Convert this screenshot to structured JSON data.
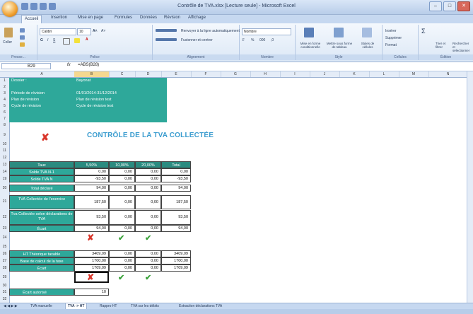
{
  "window": {
    "title": "Contrôle de TVA.xlsx [Lecture seule] - Microsoft Excel",
    "buttons": [
      "–",
      "□",
      "✕"
    ]
  },
  "ribbon_tabs": [
    "Accueil",
    "Insertion",
    "Mise en page",
    "Formules",
    "Données",
    "Révision",
    "Affichage"
  ],
  "ribbon": {
    "paste_label": "Coller",
    "font_name": "Calibri",
    "font_size": "10",
    "wrap_text": "Renvoyer à la ligne automatiquement",
    "merge_center": "Fusionner et centrer",
    "number_format": "Nombre",
    "conditional": "Mise en forme conditionnelle",
    "format_table": "Mettre sous forme de tableau",
    "cell_styles": "Styles de cellules",
    "insert": "Insérer",
    "delete": "Supprimer",
    "format": "Format",
    "sort_filter": "Trier et filtrer",
    "find_select": "Rechercher et sélectionner",
    "groups": [
      "Presse...",
      "Police",
      "Alignement",
      "Nombre",
      "Style",
      "Cellules",
      "Édition"
    ]
  },
  "formula_bar": {
    "name_box": "B29",
    "fx": "fx",
    "formula": "=ABS(B28)"
  },
  "columns": [
    "A",
    "B",
    "C",
    "D",
    "E",
    "F",
    "G",
    "H",
    "I",
    "J",
    "K",
    "L",
    "M",
    "N"
  ],
  "rows": [
    "1",
    "2",
    "3",
    "4",
    "5",
    "6",
    "7",
    "8",
    "9",
    "10",
    "11",
    "12",
    "13",
    "14",
    "19",
    "20",
    "21",
    "22",
    "23",
    "24",
    "25",
    "26",
    "27",
    "28",
    "29",
    "30",
    "31",
    "32"
  ],
  "info": {
    "dossier_label": "Dossier :",
    "dossier_value": "Bayonat",
    "periode_label": "Période de révision",
    "periode_value": "01/01/2014-31/12/2014",
    "plan_label": "Plan de révision",
    "plan_value": "Plan de révision test",
    "cycle_label": "Cycle de révision",
    "cycle_value": "Cycle de révision test"
  },
  "main_title": "CONTRÔLE DE LA TVA COLLECTÉE",
  "table1": {
    "headers": [
      "Taux",
      "5,50%",
      "10,00%",
      "20,00%",
      "Total"
    ],
    "rows": [
      {
        "label": "Solde TVA N-1",
        "values": [
          "0,00",
          "0,00",
          "0,00",
          "0,00"
        ]
      },
      {
        "label": "Solde TVA N",
        "values": [
          "-93,50",
          "0,00",
          "0,00",
          "-93,50"
        ]
      },
      {
        "label": "Total déclaré",
        "values": [
          "94,00",
          "0,00",
          "0,00",
          "94,00"
        ]
      },
      {
        "label": "TVA Collectée de l'exercice",
        "values": [
          "187,50",
          "0,00",
          "0,00",
          "187,50"
        ]
      },
      {
        "label": "Tva Collectée selon déclarations de TVA",
        "values": [
          "93,50",
          "0,00",
          "0,00",
          "93,50"
        ]
      },
      {
        "label": "Écart",
        "values": [
          "94,00",
          "0,00",
          "0,00",
          "94,00"
        ]
      }
    ]
  },
  "table2": {
    "rows": [
      {
        "label": "HT Théorique taxable",
        "values": [
          "3409,09",
          "0,00",
          "0,00",
          "3409,09"
        ]
      },
      {
        "label": "Base de calcul de la taxe",
        "values": [
          "1700,00",
          "0,00",
          "0,00",
          "1700,00"
        ]
      },
      {
        "label": "Écart",
        "values": [
          "1709,09",
          "0,00",
          "0,00",
          "1709,09"
        ]
      }
    ]
  },
  "tolerance": {
    "label": "Écart autorisé",
    "value": "10"
  },
  "sheet_tabs": [
    "TVA manuelle",
    "TVA -> HT",
    "Rappro HT",
    "TVA sur les débits",
    "Extraction déclarations TVA"
  ],
  "active_sheet": "TVA -> HT",
  "marks": {
    "cross": "✘",
    "check": "✔"
  },
  "colors": {
    "teal": "#2ea89a",
    "dark_teal": "#2b8b80",
    "title_blue": "#3a9ccf",
    "cross_red": "#d9362b",
    "check_green": "#3aa23a"
  }
}
